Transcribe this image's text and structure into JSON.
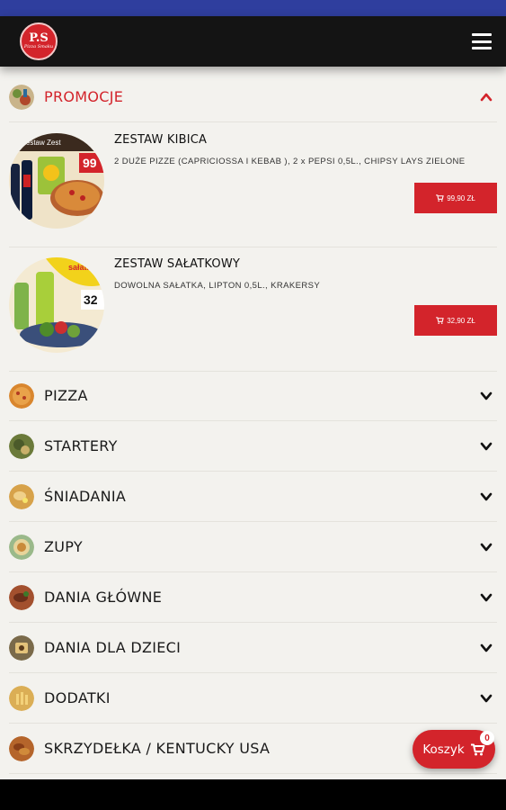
{
  "header": {
    "logo_mono": "P.S",
    "logo_sub": "Pizza Smaku"
  },
  "colors": {
    "accent": "#d3242b",
    "header_bg": "#141414",
    "status_bar": "#2f3e9e",
    "page_bg": "#f3f2ee"
  },
  "promo": {
    "title": "PROMOCJE",
    "icon": "promo-food-icon",
    "expanded": true,
    "products": [
      {
        "name": "ZESTAW KIBICA",
        "description": "2 DUŻE PIZZE (CAPRICIOSSA I KEBAB ), 2 x PEPSI 0,5L., CHIPSY LAYS ZIELONE",
        "price": "99,90 ZŁ",
        "image_badge": "99",
        "image_caption": "Zestaw Zest"
      },
      {
        "name": "ZESTAW SAŁATKOWY",
        "description": "DOWOLNA SAŁATKA, LIPTON 0,5L., KRAKERSY",
        "price": "32,90 ZŁ",
        "image_badge": "32",
        "image_caption": "sałatk"
      }
    ]
  },
  "categories": [
    {
      "label": "PIZZA",
      "icon": "pizza-icon",
      "color": "#d9862e"
    },
    {
      "label": "STARTERY",
      "icon": "starter-icon",
      "color": "#6b7a3a"
    },
    {
      "label": "ŚNIADANIA",
      "icon": "breakfast-icon",
      "color": "#d7a24a"
    },
    {
      "label": "ZUPY",
      "icon": "soup-icon",
      "color": "#9ab98a"
    },
    {
      "label": "DANIA GŁÓWNE",
      "icon": "main-dish-icon",
      "color": "#a3502e"
    },
    {
      "label": "DANIA DLA DZIECI",
      "icon": "kids-dish-icon",
      "color": "#7a6a4a"
    },
    {
      "label": "DODATKI",
      "icon": "sides-icon",
      "color": "#dbae55"
    },
    {
      "label": "SKRZYDEŁKA / KENTUCKY USA",
      "icon": "wings-icon",
      "color": "#b5652b"
    }
  ],
  "cart": {
    "label": "Koszyk",
    "count": "0"
  }
}
